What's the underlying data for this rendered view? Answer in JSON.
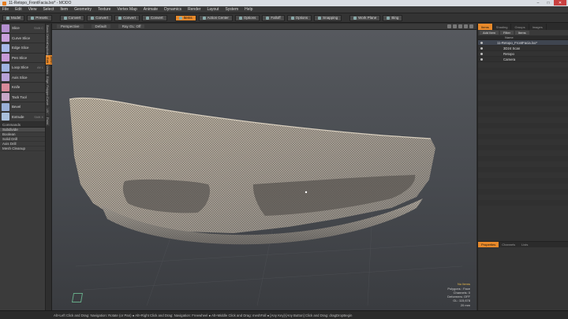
{
  "window": {
    "title": "11-Retopo_FrontFacia.lxo* - MODO",
    "controls": [
      "–",
      "□",
      "✕"
    ]
  },
  "menu": [
    "File",
    "Edit",
    "View",
    "Select",
    "Item",
    "Geometry",
    "Texture",
    "Vertex Map",
    "Animate",
    "Dynamics",
    "Render",
    "Layout",
    "System",
    "Help"
  ],
  "toolbar": {
    "buttons": [
      "Model",
      "Presets",
      "Convert",
      "Convert",
      "Convert",
      "Convert",
      "Items",
      "Action Center",
      "Options",
      "Falloff",
      "Options",
      "Snapping",
      "Work Plane",
      "Bing"
    ],
    "active_index": 6
  },
  "left_tools": [
    {
      "label": "Slice",
      "key": "Shift C",
      "color": "#b48fd0"
    },
    {
      "label": "Curve Slice",
      "key": "",
      "color": "#c9a0dc"
    },
    {
      "label": "Edge Slice",
      "key": "",
      "color": "#a7b8e8"
    },
    {
      "label": "Pen Slice",
      "key": "",
      "color": "#c79ad8"
    },
    {
      "label": "Loop Slice",
      "key": "Alt L",
      "color": "#9fb3e0"
    },
    {
      "label": "Axis Slice",
      "key": "",
      "color": "#b8a2d8"
    },
    {
      "label": "Knife",
      "key": "",
      "color": "#d88a9a"
    },
    {
      "label": "Tack Tool",
      "key": "",
      "color": "#c8a8c8"
    },
    {
      "label": "Bevel",
      "key": "",
      "color": "#9ab0d8"
    },
    {
      "label": "Extrude",
      "key": "Shift X",
      "color": "#a9c0dc"
    }
  ],
  "commands": {
    "header": "Commands",
    "items": [
      "Subdivide",
      "Boolean",
      "Solid Drill",
      "Axis Drill",
      "Mesh Cleanup"
    ]
  },
  "vertical_tabs": [
    "Basic",
    "Deform",
    "Duplicate",
    "Mesh Edit",
    "Vertex",
    "Edge",
    "Polygon",
    "Curve",
    "UV",
    "Paint"
  ],
  "vertical_tab_active": 3,
  "viewport": {
    "tabs": [
      "Perspective",
      "Default",
      "Ray GL: Off"
    ],
    "info": [
      "No Items",
      "Polygons : Face",
      "Channels: 0",
      "Deformers: OFF",
      "GL: 115,678",
      "20 mm"
    ]
  },
  "right_panel": {
    "tabs": [
      "Items",
      "Shading",
      "Groups",
      "Images"
    ],
    "sub_buttons": [
      "Add Item",
      "Filter",
      "Items"
    ],
    "column_header": "Name",
    "items": [
      {
        "name": "11-Retopo_FrontFacia.lxo*",
        "indent": 0,
        "selected": true
      },
      {
        "name": "3D24 Scan",
        "indent": 1,
        "selected": false
      },
      {
        "name": "Retopo",
        "indent": 1,
        "selected": false
      },
      {
        "name": "Camera",
        "indent": 1,
        "selected": false
      }
    ],
    "props_tabs": [
      "Properties",
      "Channels",
      "Lists"
    ]
  },
  "status": {
    "text": "Alt+Left Click and Drag: Navigation: Rotate (or Pan) ● Alt+Right Click and Drag: Navigation: Freewheel ● Alt+Middle Click and Drag: meshFall ● [Any Key]-[Any Button] Click and Drag: dragDropBegin"
  }
}
